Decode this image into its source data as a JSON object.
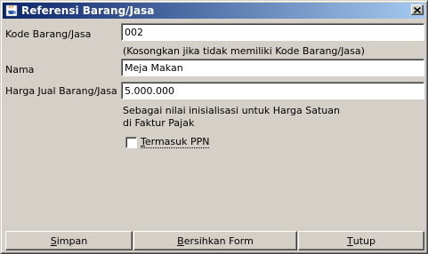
{
  "window": {
    "title": "Referensi Barang/Jasa",
    "close_glyph": "✕"
  },
  "form": {
    "kode": {
      "label": "Kode Barang/Jasa",
      "value": "002",
      "hint": "(Kosongkan jika tidak memiliki Kode Barang/Jasa)"
    },
    "nama": {
      "label": "Nama",
      "value": "Meja Makan"
    },
    "harga": {
      "label": "Harga Jual Barang/Jasa",
      "value": "5.000.000",
      "note_line1": "Sebagai nilai inisialisasi untuk Harga Satuan",
      "note_line2": "di Faktur Pajak"
    },
    "ppn": {
      "label_mnemonic": "T",
      "label_rest": "ermasuk PPN",
      "checked": false
    }
  },
  "buttons": {
    "simpan": {
      "mnemonic": "S",
      "rest": "impan"
    },
    "bersihkan": {
      "mnemonic": "B",
      "rest": "ersihkan Form"
    },
    "tutup": {
      "mnemonic": "T",
      "rest": "utup"
    }
  },
  "colors": {
    "titlebar_start": "#0a246a",
    "titlebar_end": "#a6caf0",
    "window_bg": "#d4d0c8"
  }
}
